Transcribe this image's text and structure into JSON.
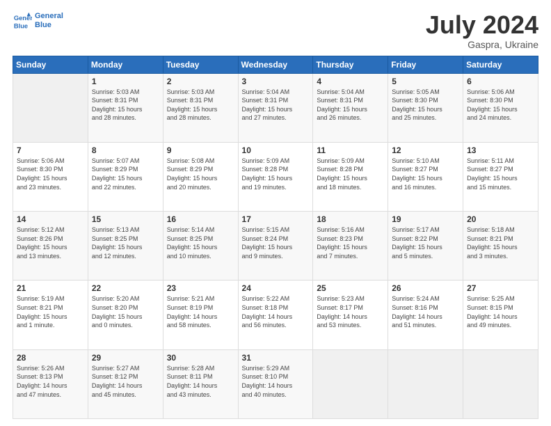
{
  "logo": {
    "line1": "General",
    "line2": "Blue"
  },
  "title": "July 2024",
  "subtitle": "Gaspra, Ukraine",
  "header_labels": [
    "Sunday",
    "Monday",
    "Tuesday",
    "Wednesday",
    "Thursday",
    "Friday",
    "Saturday"
  ],
  "weeks": [
    [
      {
        "day": "",
        "info": ""
      },
      {
        "day": "1",
        "info": "Sunrise: 5:03 AM\nSunset: 8:31 PM\nDaylight: 15 hours\nand 28 minutes."
      },
      {
        "day": "2",
        "info": "Sunrise: 5:03 AM\nSunset: 8:31 PM\nDaylight: 15 hours\nand 28 minutes."
      },
      {
        "day": "3",
        "info": "Sunrise: 5:04 AM\nSunset: 8:31 PM\nDaylight: 15 hours\nand 27 minutes."
      },
      {
        "day": "4",
        "info": "Sunrise: 5:04 AM\nSunset: 8:31 PM\nDaylight: 15 hours\nand 26 minutes."
      },
      {
        "day": "5",
        "info": "Sunrise: 5:05 AM\nSunset: 8:30 PM\nDaylight: 15 hours\nand 25 minutes."
      },
      {
        "day": "6",
        "info": "Sunrise: 5:06 AM\nSunset: 8:30 PM\nDaylight: 15 hours\nand 24 minutes."
      }
    ],
    [
      {
        "day": "7",
        "info": "Sunrise: 5:06 AM\nSunset: 8:30 PM\nDaylight: 15 hours\nand 23 minutes."
      },
      {
        "day": "8",
        "info": "Sunrise: 5:07 AM\nSunset: 8:29 PM\nDaylight: 15 hours\nand 22 minutes."
      },
      {
        "day": "9",
        "info": "Sunrise: 5:08 AM\nSunset: 8:29 PM\nDaylight: 15 hours\nand 20 minutes."
      },
      {
        "day": "10",
        "info": "Sunrise: 5:09 AM\nSunset: 8:28 PM\nDaylight: 15 hours\nand 19 minutes."
      },
      {
        "day": "11",
        "info": "Sunrise: 5:09 AM\nSunset: 8:28 PM\nDaylight: 15 hours\nand 18 minutes."
      },
      {
        "day": "12",
        "info": "Sunrise: 5:10 AM\nSunset: 8:27 PM\nDaylight: 15 hours\nand 16 minutes."
      },
      {
        "day": "13",
        "info": "Sunrise: 5:11 AM\nSunset: 8:27 PM\nDaylight: 15 hours\nand 15 minutes."
      }
    ],
    [
      {
        "day": "14",
        "info": "Sunrise: 5:12 AM\nSunset: 8:26 PM\nDaylight: 15 hours\nand 13 minutes."
      },
      {
        "day": "15",
        "info": "Sunrise: 5:13 AM\nSunset: 8:25 PM\nDaylight: 15 hours\nand 12 minutes."
      },
      {
        "day": "16",
        "info": "Sunrise: 5:14 AM\nSunset: 8:25 PM\nDaylight: 15 hours\nand 10 minutes."
      },
      {
        "day": "17",
        "info": "Sunrise: 5:15 AM\nSunset: 8:24 PM\nDaylight: 15 hours\nand 9 minutes."
      },
      {
        "day": "18",
        "info": "Sunrise: 5:16 AM\nSunset: 8:23 PM\nDaylight: 15 hours\nand 7 minutes."
      },
      {
        "day": "19",
        "info": "Sunrise: 5:17 AM\nSunset: 8:22 PM\nDaylight: 15 hours\nand 5 minutes."
      },
      {
        "day": "20",
        "info": "Sunrise: 5:18 AM\nSunset: 8:21 PM\nDaylight: 15 hours\nand 3 minutes."
      }
    ],
    [
      {
        "day": "21",
        "info": "Sunrise: 5:19 AM\nSunset: 8:21 PM\nDaylight: 15 hours\nand 1 minute."
      },
      {
        "day": "22",
        "info": "Sunrise: 5:20 AM\nSunset: 8:20 PM\nDaylight: 15 hours\nand 0 minutes."
      },
      {
        "day": "23",
        "info": "Sunrise: 5:21 AM\nSunset: 8:19 PM\nDaylight: 14 hours\nand 58 minutes."
      },
      {
        "day": "24",
        "info": "Sunrise: 5:22 AM\nSunset: 8:18 PM\nDaylight: 14 hours\nand 56 minutes."
      },
      {
        "day": "25",
        "info": "Sunrise: 5:23 AM\nSunset: 8:17 PM\nDaylight: 14 hours\nand 53 minutes."
      },
      {
        "day": "26",
        "info": "Sunrise: 5:24 AM\nSunset: 8:16 PM\nDaylight: 14 hours\nand 51 minutes."
      },
      {
        "day": "27",
        "info": "Sunrise: 5:25 AM\nSunset: 8:15 PM\nDaylight: 14 hours\nand 49 minutes."
      }
    ],
    [
      {
        "day": "28",
        "info": "Sunrise: 5:26 AM\nSunset: 8:13 PM\nDaylight: 14 hours\nand 47 minutes."
      },
      {
        "day": "29",
        "info": "Sunrise: 5:27 AM\nSunset: 8:12 PM\nDaylight: 14 hours\nand 45 minutes."
      },
      {
        "day": "30",
        "info": "Sunrise: 5:28 AM\nSunset: 8:11 PM\nDaylight: 14 hours\nand 43 minutes."
      },
      {
        "day": "31",
        "info": "Sunrise: 5:29 AM\nSunset: 8:10 PM\nDaylight: 14 hours\nand 40 minutes."
      },
      {
        "day": "",
        "info": ""
      },
      {
        "day": "",
        "info": ""
      },
      {
        "day": "",
        "info": ""
      }
    ]
  ]
}
